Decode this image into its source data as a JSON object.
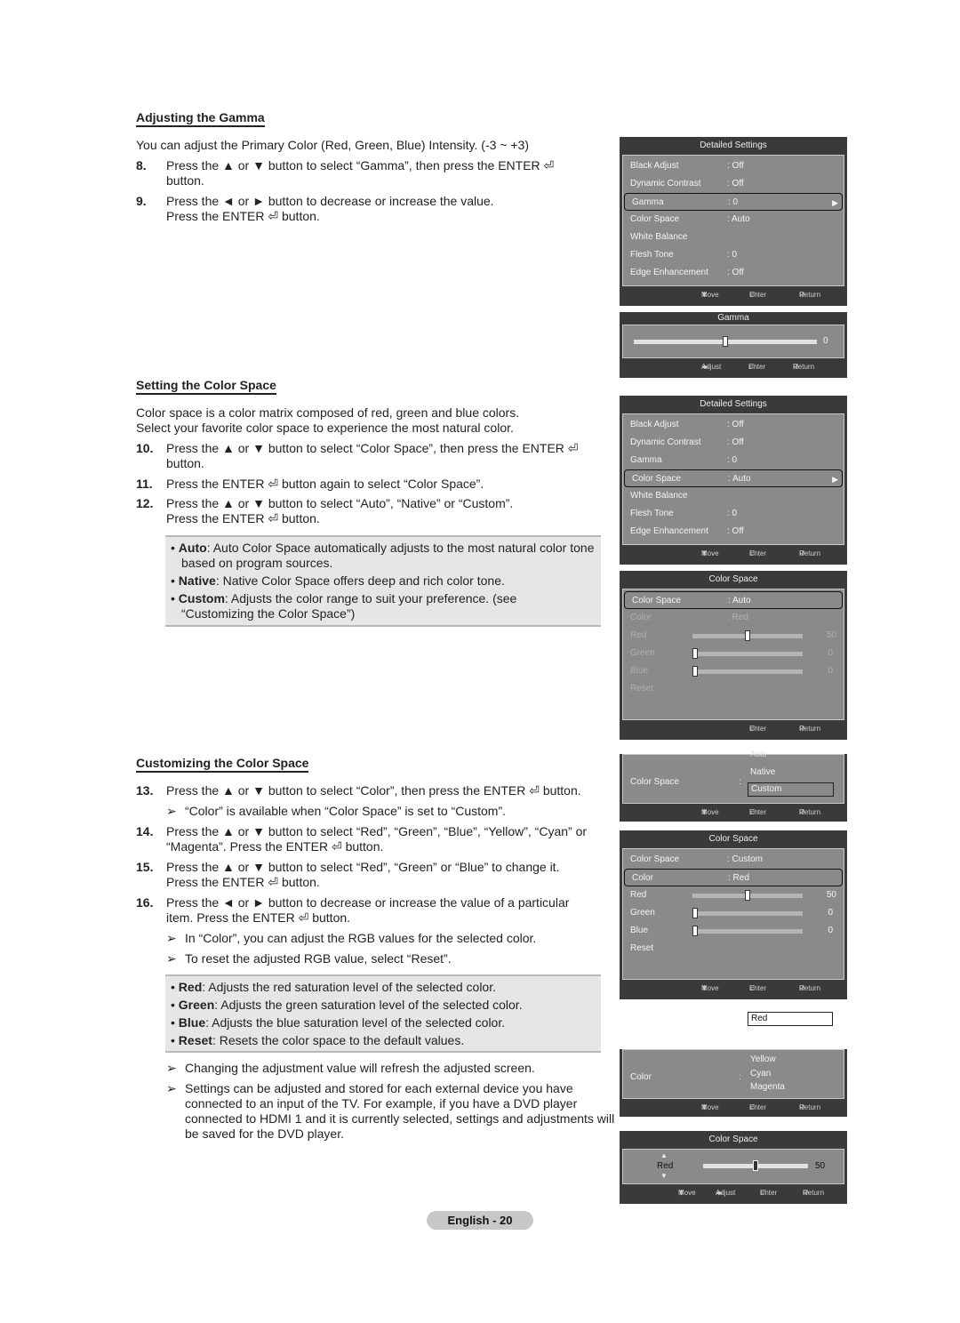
{
  "sections": {
    "gamma": {
      "title": "Adjusting the Gamma",
      "intro": "You can adjust the Primary Color (Red, Green, Blue) Intensity. (-3 ~ +3)",
      "steps": [
        {
          "num": "8.",
          "text": "Press the ▲ or ▼ button to select “Gamma”, then press the ENTER ⏎ button."
        },
        {
          "num": "9.",
          "text": "Press the ◄ or ► button to decrease or increase the value. Press the ENTER ⏎ button."
        }
      ]
    },
    "color_space": {
      "title": "Setting the Color Space",
      "intro_1": "Color space is a color matrix composed of red, green and blue colors.",
      "intro_2": "Select your favorite color space to experience the most natural color.",
      "steps": [
        {
          "num": "10.",
          "text": "Press the ▲ or ▼ button to select “Color Space”, then press the ENTER ⏎ button."
        },
        {
          "num": "11.",
          "text": "Press the ENTER ⏎ button again to select “Color Space”."
        },
        {
          "num": "12.",
          "text": "Press the ▲ or ▼ button to select “Auto”, “Native” or “Custom”. Press the ENTER ⏎ button."
        }
      ],
      "bullets": [
        {
          "term": "Auto",
          "text": ": Auto Color Space automatically adjusts to the most natural color tone based on program sources."
        },
        {
          "term": "Native",
          "text": ": Native Color Space offers deep and rich color tone."
        },
        {
          "term": "Custom",
          "text": ": Adjusts the color range to suit your preference. (see “Customizing the Color Space”)"
        }
      ]
    },
    "customizing": {
      "title": "Customizing the Color Space",
      "step13": {
        "num": "13.",
        "text": "Press the ▲ or ▼ button to select “Color”, then press the ENTER ⏎ button."
      },
      "note13": "“Color” is available when “Color Space” is set to “Custom”.",
      "step14": {
        "num": "14.",
        "text": "Press the ▲ or ▼ button to select “Red”, “Green”, “Blue”, “Yellow”, “Cyan” or “Magenta”. Press the ENTER ⏎ button."
      },
      "step15": {
        "num": "15.",
        "text": "Press the ▲ or ▼ button to select “Red”, “Green” or “Blue” to change it. Press the ENTER ⏎ button."
      },
      "step16": {
        "num": "16.",
        "text": "Press the ◄ or ► button to decrease or increase the value of a particular item. Press the ENTER ⏎ button."
      },
      "note16a": "In “Color”, you can adjust the RGB values for the selected color.",
      "note16b": "To reset the adjusted RGB value, select “Reset”.",
      "bullets": [
        {
          "term": "Red",
          "text": ": Adjusts the red saturation level of the selected color."
        },
        {
          "term": "Green",
          "text": ": Adjusts the green saturation level of the selected color."
        },
        {
          "term": "Blue",
          "text": ": Adjusts the blue saturation level of the selected color."
        },
        {
          "term": "Reset",
          "text": ": Resets the color space to the default values."
        }
      ],
      "note_refresh": "Changing the adjustment value will refresh the adjusted screen.",
      "note_stored": "Settings can be adjusted and stored for each external device you have connected to an input of the TV. For example, if you have a DVD player connected to HDMI 1 and it is currently selected, settings and adjustments will be saved for the DVD player."
    }
  },
  "arrow_glyph": "➢",
  "bullet_glyph": "•",
  "footer": {
    "move": "Move",
    "enter": "Enter",
    "return": "Return",
    "adjust": "Adjust"
  },
  "osd": {
    "detailed_title": "Detailed Settings",
    "detailed_items": [
      {
        "label": "Black Adjust",
        "value": ": Off"
      },
      {
        "label": "Dynamic Contrast",
        "value": ": Off"
      },
      {
        "label": "Gamma",
        "value": ": 0"
      },
      {
        "label": "Color Space",
        "value": ": Auto"
      },
      {
        "label": "White Balance",
        "value": ""
      },
      {
        "label": "Flesh Tone",
        "value": ": 0"
      },
      {
        "label": "Edge Enhancement",
        "value": ": Off"
      }
    ],
    "gamma_panel": {
      "title": "Gamma",
      "value": "0",
      "level": 0.5
    },
    "color_space_title": "Color Space",
    "cs_auto": {
      "items": [
        {
          "label": "Color Space",
          "value": ": Auto"
        },
        {
          "label": "Color",
          "value": ": Red"
        },
        {
          "label": "Red",
          "value": "50",
          "level": 0.5
        },
        {
          "label": "Green",
          "value": "0",
          "level": 0
        },
        {
          "label": "Blue",
          "value": "0",
          "level": 0
        },
        {
          "label": "Reset",
          "value": ""
        }
      ]
    },
    "cs_dropdown": {
      "label": "Color Space",
      "options": [
        "Auto",
        "Native",
        "Custom"
      ],
      "selected": "Custom"
    },
    "cs_custom": {
      "items": [
        {
          "label": "Color Space",
          "value": ": Custom"
        },
        {
          "label": "Color",
          "value": ": Red"
        },
        {
          "label": "Red",
          "value": "50",
          "level": 0.5
        },
        {
          "label": "Green",
          "value": "0",
          "level": 0
        },
        {
          "label": "Blue",
          "value": "0",
          "level": 0
        },
        {
          "label": "Reset",
          "value": ""
        }
      ]
    },
    "color_selected": "Red",
    "color_dropdown": {
      "label": "Color",
      "options": [
        "Yellow",
        "Cyan",
        "Magenta"
      ]
    },
    "red_adjust": {
      "title": "Color Space",
      "label": "Red",
      "value": "50",
      "level": 0.5
    }
  },
  "page_label": "English - 20"
}
